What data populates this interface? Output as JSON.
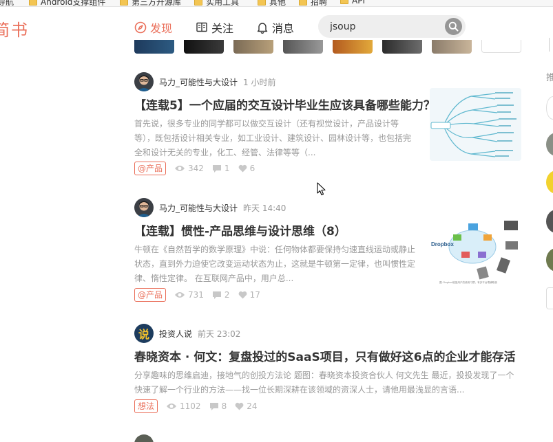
{
  "bookmarks": [
    "Android支撑组件",
    "第三方开源库",
    "实用工具",
    "其他",
    "招聘",
    "API"
  ],
  "header": {
    "logo": "简书",
    "nav": {
      "discover": "发现",
      "follow": "关注",
      "messages": "消息"
    },
    "search": {
      "value": "jsoup"
    }
  },
  "colors": {
    "brand": "#ea6f5a",
    "meta_gray": "#969696",
    "stat_gray": "#b4b4b4"
  },
  "sidebar": {
    "heading_fragment": "推"
  },
  "articles": [
    {
      "author": "马力_可能性与大设计",
      "time": "1 小时前",
      "title": "【连载5】一个应届的交互设计毕业生应该具备哪些能力？",
      "abstract": "首先说，很多专业的同学都可以做交互设计（还有视觉设计，产品设计等等），既包括设计相关专业，如工业设计、建筑设计、园林设计等，也包括完全和设计无关的专业，化工、经管、法律等等（...",
      "collection": "@产品",
      "views": "342",
      "comments": "1",
      "likes": "6",
      "cover_icon": "mindmap-image"
    },
    {
      "author": "马力_可能性与大设计",
      "time": "昨天 14:40",
      "title": "【连载】惯性-产品思维与设计思维（8）",
      "abstract": "牛顿在《自然哲学的数学原理》中说：任何物体都要保持匀速直线运动或静止状态，直到外力迫使它改变运动状态为止，这就是牛顿第一定律，也叫惯性定律、惰性定律。 在互联网产品中，用户总...",
      "collection": "@产品",
      "views": "731",
      "comments": "2",
      "likes": "17",
      "cover_label": "Dropbox",
      "cover_caption": "图: Dropbox能量用户的使用习惯，有多平台端辅助使"
    },
    {
      "author": "投资人说",
      "time": "前天 23:02",
      "title": "春晓资本 · 何文：复盘投过的SaaS项目，只有做好这6点的企业才能存活",
      "abstract": "分享趣味的思维启迪，接地气的创投方法论 题图：春晓资本投资合伙人 何文先生 最近，投投发现了一个快速了解一个行业的方法——找一位长期深耕在该领域的资深人士，请他用最浅显的言语...",
      "collection": "想法",
      "views": "1102",
      "comments": "8",
      "likes": "24",
      "avatar_char": "说"
    },
    {
      "author": "",
      "time": ""
    }
  ]
}
